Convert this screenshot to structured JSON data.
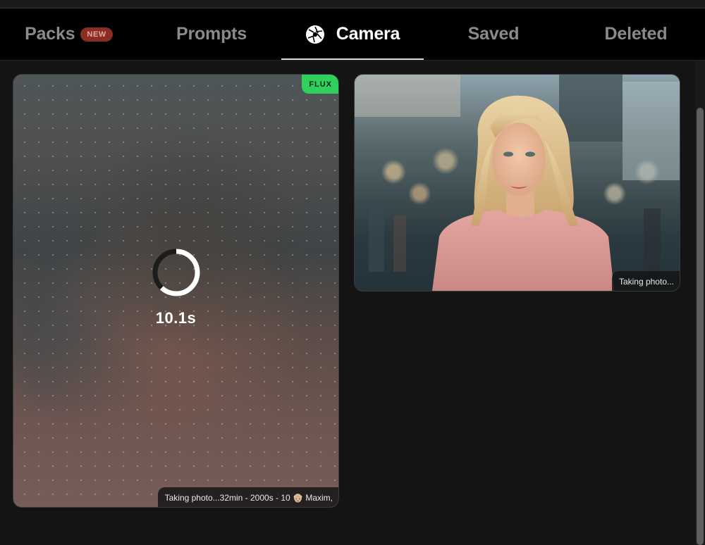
{
  "tabs": {
    "packs": {
      "label": "Packs",
      "badge": "NEW"
    },
    "prompts": {
      "label": "Prompts"
    },
    "camera": {
      "label": "Camera"
    },
    "saved": {
      "label": "Saved"
    },
    "deleted": {
      "label": "Deleted"
    }
  },
  "icons": {
    "camera_tab": "aperture-icon",
    "spinner": "loading-spinner"
  },
  "cards": [
    {
      "model_badge": "FLUX",
      "timer": "10.1s",
      "progress": 0.62,
      "caption": "Taking photo...32min - 2000s - 10 👴🏼 Maxim,"
    },
    {
      "caption": "Taking photo..."
    }
  ],
  "colors": {
    "background": "#141414",
    "tabbar": "#000000",
    "active_tab": "#ffffff",
    "inactive_tab": "#8a8a8a",
    "new_badge_bg": "#8a2e25",
    "flux_badge_bg": "#2fd15c"
  }
}
